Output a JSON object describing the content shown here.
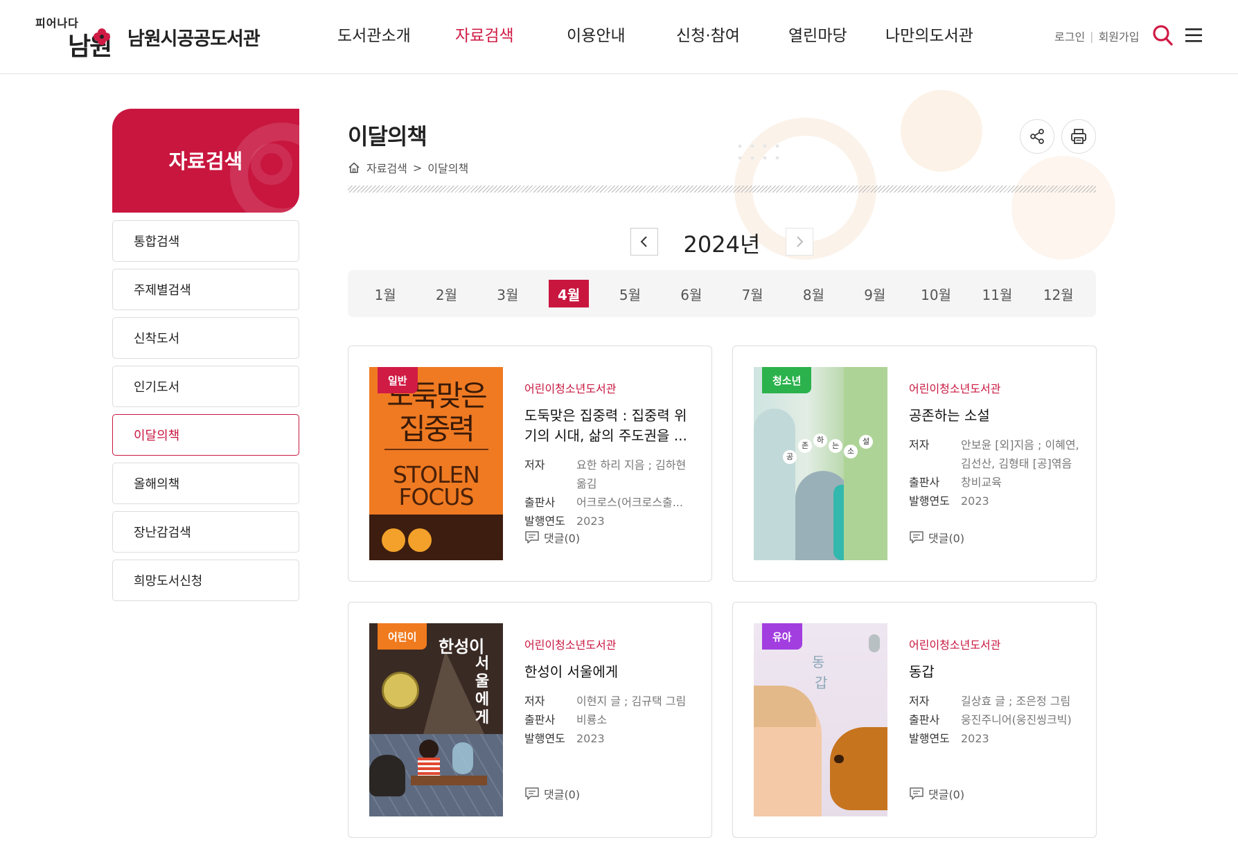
{
  "header": {
    "slogan": "피어나다",
    "logo_mark": "남원",
    "site_name": "남원시공공도서관",
    "nav": [
      "도서관소개",
      "자료검색",
      "이용안내",
      "신청·참여",
      "열린마당",
      "나만의도서관"
    ],
    "active_nav_index": 1,
    "login": "로그인",
    "signup": "회원가입"
  },
  "sidebar": {
    "title": "자료검색",
    "items": [
      "통합검색",
      "주제별검색",
      "신착도서",
      "인기도서",
      "이달의책",
      "올해의책",
      "장난감검색",
      "희망도서신청"
    ],
    "active_index": 4
  },
  "page": {
    "title": "이달의책",
    "breadcrumb": [
      "자료검색",
      "이달의책"
    ],
    "breadcrumb_sep": ">"
  },
  "year_nav": {
    "year": "2024년"
  },
  "months": {
    "items": [
      "1월",
      "2월",
      "3월",
      "4월",
      "5월",
      "6월",
      "7월",
      "8월",
      "9월",
      "10월",
      "11월",
      "12월"
    ],
    "active_index": 3
  },
  "labels": {
    "author": "저자",
    "publisher": "출판사",
    "year": "발행연도"
  },
  "books": [
    {
      "badge": "일반",
      "badge_color": "#d01b45",
      "library": "어린이청소년도서관",
      "title": "도둑맞은 집중력 : 집중력 위기의 시대, 삶의 주도권을 ...",
      "author": "요한 하리 지음 ; 김하현 옮김",
      "publisher": "어크로스(어크로스출...",
      "year": "2023",
      "comments": "댓글(0)",
      "cover_title_1": "도둑맞은",
      "cover_title_2": "집중력",
      "cover_en_1": "STOLEN",
      "cover_en_2": "FOCUS"
    },
    {
      "badge": "청소년",
      "badge_color": "#2bb24c",
      "library": "어린이청소년도서관",
      "title": "공존하는 소설",
      "author": "안보윤 [외]지음 ; 이혜연, 김선산, 김형태 [공]엮음",
      "publisher": "창비교육",
      "year": "2023",
      "comments": "댓글(0)",
      "cover_chars": [
        "공",
        "존",
        "하",
        "는",
        "소",
        "설"
      ]
    },
    {
      "badge": "어린이",
      "badge_color": "#f07a1e",
      "library": "어린이청소년도서관",
      "title": "한성이 서울에게",
      "author": "이현지 글 ; 김규택 그림",
      "publisher": "비룡소",
      "year": "2023",
      "comments": "댓글(0)",
      "cover_title": "한성이",
      "cover_title_v": [
        "서",
        "울",
        "에",
        "게"
      ]
    },
    {
      "badge": "유아",
      "badge_color": "#a23de0",
      "library": "어린이청소년도서관",
      "title": "동갑",
      "author": "길상효 글 ; 조은정 그림",
      "publisher": "웅진주니어(웅진씽크빅)",
      "year": "2023",
      "comments": "댓글(0)",
      "cover_chars": [
        "동",
        "갑"
      ]
    }
  ],
  "colors": {
    "brand": "#c8163f",
    "nav_active": "#d01b45"
  }
}
